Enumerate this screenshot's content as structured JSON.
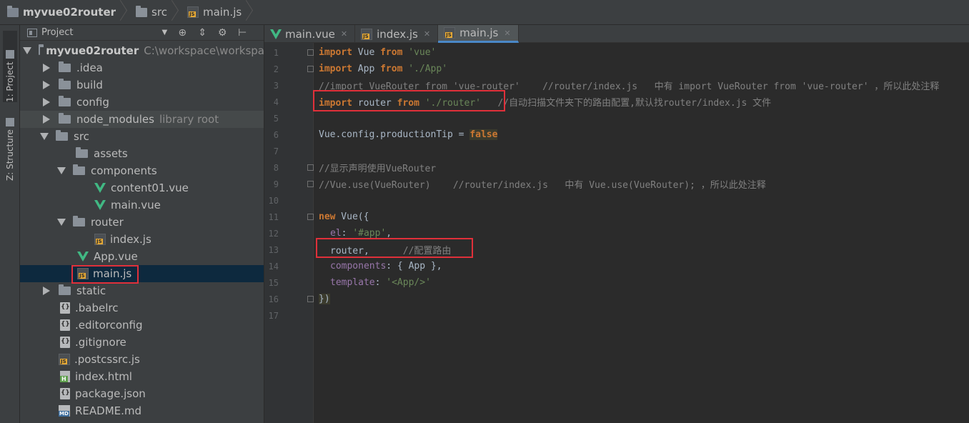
{
  "breadcrumb": {
    "project": "myvue02router",
    "folder": "src",
    "file": "main.js"
  },
  "toolwindows": {
    "project": "1: Project",
    "structure": "Z: Structure"
  },
  "project_panel": {
    "title": "Project",
    "root_name": "myvue02router",
    "root_path": "C:\\workspace\\workspa",
    "items": [
      {
        "name": ".idea"
      },
      {
        "name": "build"
      },
      {
        "name": "config"
      },
      {
        "name": "node_modules",
        "note": "library root"
      },
      {
        "name": "src"
      },
      {
        "name": "assets"
      },
      {
        "name": "components"
      },
      {
        "name": "content01.vue"
      },
      {
        "name": "main.vue"
      },
      {
        "name": "router"
      },
      {
        "name": "index.js"
      },
      {
        "name": "App.vue"
      },
      {
        "name": "main.js"
      },
      {
        "name": "static"
      },
      {
        "name": ".babelrc"
      },
      {
        "name": ".editorconfig"
      },
      {
        "name": ".gitignore"
      },
      {
        "name": ".postcssrc.js"
      },
      {
        "name": "index.html"
      },
      {
        "name": "package.json"
      },
      {
        "name": "README.md"
      }
    ]
  },
  "tabs": [
    {
      "label": "main.vue",
      "active": false
    },
    {
      "label": "index.js",
      "active": false
    },
    {
      "label": "main.js",
      "active": true
    }
  ],
  "code": {
    "l1": {
      "kw1": "import",
      "t1": " Vue ",
      "kw2": "from",
      "s": " 'vue'"
    },
    "l2": {
      "kw1": "import",
      "t1": " App ",
      "kw2": "from",
      "s": " './App'"
    },
    "l3": {
      "c": "//import VueRouter from 'vue-router'    //router/index.js   中有 import VueRouter from 'vue-router' ，所以此处注释"
    },
    "l4": {
      "kw1": "import",
      "t1": " router ",
      "kw2": "from",
      "s": " './router'",
      "c": "   //自动扫描文件夹下的路由配置,默认找router/index.js 文件"
    },
    "l6": {
      "t1": "Vue.config.productionTip = ",
      "kw": "false"
    },
    "l8": {
      "c": "//显示声明使用VueRouter"
    },
    "l9": {
      "c": "//Vue.use(VueRouter)    //router/index.js   中有 Vue.use(VueRouter); ，所以此处注释"
    },
    "l11": {
      "kw": "new",
      "t1": " Vue({"
    },
    "l12": {
      "p": "el",
      "t1": ": ",
      "s": "'#app'",
      "t2": ","
    },
    "l13": {
      "t1": "router,",
      "c": "      //配置路由"
    },
    "l14": {
      "p": "components",
      "t1": ": { App },",
      "t2": ""
    },
    "l15": {
      "p": "template",
      "t1": ": ",
      "s": "'<App/>'"
    },
    "l16": {
      "t1": "})"
    }
  },
  "line_numbers": [
    "1",
    "2",
    "3",
    "4",
    "5",
    "6",
    "7",
    "8",
    "9",
    "10",
    "11",
    "12",
    "13",
    "14",
    "15",
    "16",
    "17"
  ]
}
